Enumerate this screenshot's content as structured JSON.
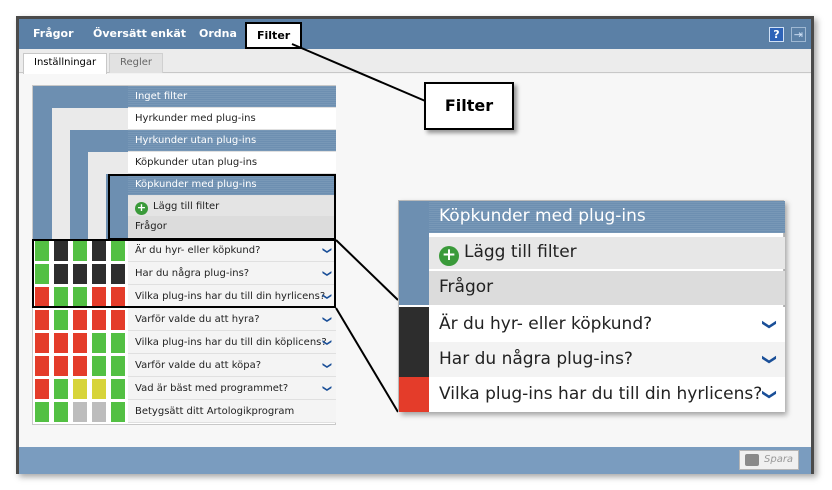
{
  "topnav": {
    "items": [
      "Frågor",
      "Översätt enkät",
      "Ordna"
    ],
    "active": "Filter",
    "help_icon": "help-icon",
    "exit_icon": "exit-icon"
  },
  "subtabs": [
    "Inställningar",
    "Regler"
  ],
  "filters": [
    "Inget filter",
    "Hyrkunder med plug-ins",
    "Hyrkunder utan plug-ins",
    "Köpkunder utan plug-ins",
    "Köpkunder med plug-ins"
  ],
  "add_filter": "Lägg till filter",
  "questions_header": "Frågor",
  "questions": [
    "Är du hyr- eller köpkund?",
    "Har du några plug-ins?",
    "Vilka plug-ins har du till din hyrlicens?",
    "Varför valde du att hyra?",
    "Vilka plug-ins har du till din köplicens?",
    "Varför valde du att köpa?",
    "Vad är bäst med programmet?",
    "Betygsätt ditt Artologikprogram"
  ],
  "matrix": [
    [
      "g",
      "k",
      "g",
      "k",
      "g"
    ],
    [
      "g",
      "k",
      "k",
      "k",
      "k"
    ],
    [
      "r",
      "g",
      "g",
      "r",
      "r"
    ],
    [
      "r",
      "g",
      "r",
      "r",
      "r"
    ],
    [
      "r",
      "r",
      "r",
      "g",
      "g"
    ],
    [
      "r",
      "r",
      "r",
      "g",
      "g"
    ],
    [
      "r",
      "g",
      "y",
      "y",
      "g"
    ],
    [
      "g",
      "g",
      "s",
      "s",
      "g"
    ]
  ],
  "callout": "Filter",
  "zoom": {
    "filter": "Köpkunder med plug-ins",
    "add_filter": "Lägg till filter",
    "header": "Frågor",
    "questions": [
      "Är du hyr- eller köpkund?",
      "Har du några plug-ins?",
      "Vilka plug-ins har du till din hyrlicens?"
    ],
    "colors": [
      "k",
      "k",
      "r"
    ]
  },
  "save_label": "Spara",
  "colors": {
    "nav": "#5b80a6",
    "stripe": "#6d8fb1",
    "green": "#53c043",
    "black": "#2d2d2d",
    "red": "#e43c2a",
    "yellow": "#d7d43a",
    "gray": "#bdbdbd"
  }
}
